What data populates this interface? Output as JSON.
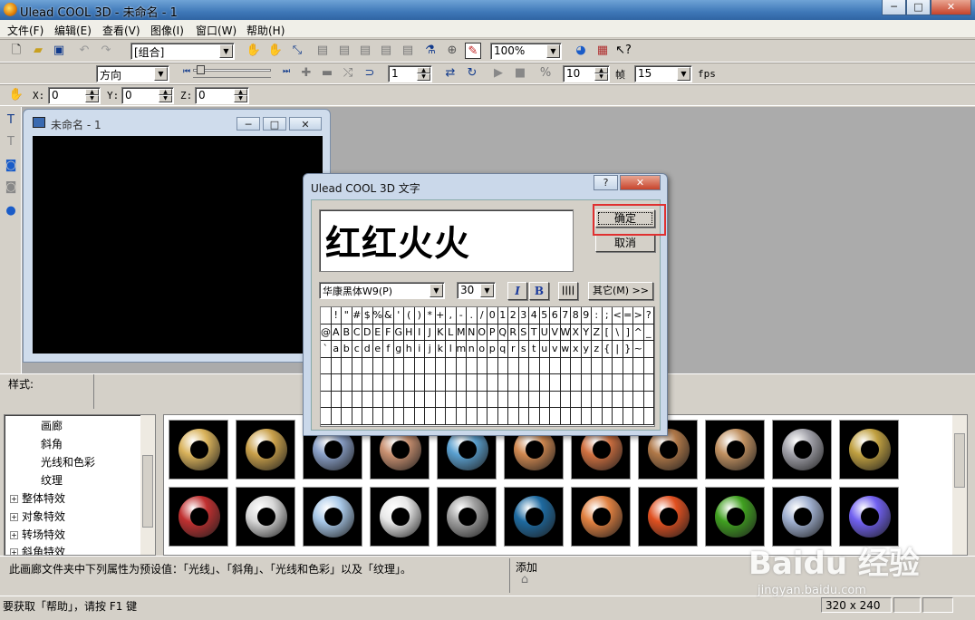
{
  "window": {
    "title": "Ulead COOL 3D - 未命名 - 1",
    "min": "─",
    "max": "□",
    "close": "✕"
  },
  "menu": [
    "文件(F)",
    "编辑(E)",
    "查看(V)",
    "图像(I)",
    "窗口(W)",
    "帮助(H)"
  ],
  "toolbar1": {
    "group_select": "[组合]",
    "zoom_select": "100%"
  },
  "toolbar2": {
    "direction_select": "方向",
    "frame_value": "1",
    "frame_total": "10",
    "frame_label": "帧",
    "fps_value": "15",
    "fps_label": "fps"
  },
  "toolbar3": {
    "x_label": "X:",
    "x_value": "0",
    "y_label": "Y:",
    "y_value": "0",
    "z_label": "Z:",
    "z_value": "0"
  },
  "doc_window": {
    "title": "未命名 - 1"
  },
  "dialog": {
    "title": "Ulead COOL 3D 文字",
    "help": "?",
    "close": "✕",
    "text_value": "红红火火",
    "ok_label": "确定",
    "cancel_label": "取消",
    "font_select": "华康黑体W9(P)",
    "size_select": "30",
    "italic_label": "I",
    "bold_label": "B",
    "spacing_label": "||||",
    "other_label": "其它(M) >>",
    "char_rows": [
      [
        " ",
        "!",
        "\"",
        "#",
        "$",
        "%",
        "&",
        "'",
        "(",
        ")",
        "*",
        "+",
        ",",
        "-",
        ".",
        "/",
        "0",
        "1",
        "2",
        "3",
        "4",
        "5",
        "6",
        "7",
        "8",
        "9",
        ":",
        ";",
        "<",
        "=",
        ">",
        "?"
      ],
      [
        "@",
        "A",
        "B",
        "C",
        "D",
        "E",
        "F",
        "G",
        "H",
        "I",
        "J",
        "K",
        "L",
        "M",
        "N",
        "O",
        "P",
        "Q",
        "R",
        "S",
        "T",
        "U",
        "V",
        "W",
        "X",
        "Y",
        "Z",
        "[",
        "\\",
        "]",
        "^",
        "_"
      ],
      [
        "`",
        "a",
        "b",
        "c",
        "d",
        "e",
        "f",
        "g",
        "h",
        "i",
        "j",
        "k",
        "l",
        "m",
        "n",
        "o",
        "p",
        "q",
        "r",
        "s",
        "t",
        "u",
        "v",
        "w",
        "x",
        "y",
        "z",
        "{",
        "|",
        "}",
        "~",
        ""
      ]
    ]
  },
  "style_panel": {
    "label": "样式:"
  },
  "tree": [
    {
      "label": "画廊",
      "level": 2
    },
    {
      "label": "斜角",
      "level": 2
    },
    {
      "label": "光线和色彩",
      "level": 2
    },
    {
      "label": "纹理",
      "level": 2
    },
    {
      "label": "整体特效",
      "level": 1
    },
    {
      "label": "对象特效",
      "level": 1
    },
    {
      "label": "转场特效",
      "level": 1
    },
    {
      "label": "斜角特效",
      "level": 1
    }
  ],
  "thumbnails": {
    "row1": [
      "#d9b25a",
      "#c9a04a",
      "#8aa0c8",
      "#c99070",
      "#5aa0d0",
      "#d08850",
      "#d07040",
      "#b07848",
      "#c09060",
      "#a0a0a8",
      "#c0a040"
    ],
    "row2": [
      "#c03030",
      "#d8d8d8",
      "#a8c8e8",
      "#e8e8e8",
      "#a0a0a0",
      "#1e6aa0",
      "#e08040",
      "#e05020",
      "#40a020",
      "#a0b0d0",
      "#7060f0"
    ]
  },
  "info": {
    "description": "此画廊文件夹中下列属性为预设值：「光线」、「斜角」、「光线和色彩」以及「纹理」。",
    "add_label": "添加"
  },
  "status": {
    "help_text": "要获取「帮助」，请按 F1 键",
    "canvas_size": "320 x 240"
  },
  "watermark": {
    "logo": "Baidu 经验",
    "url": "jingyan.baidu.com"
  }
}
